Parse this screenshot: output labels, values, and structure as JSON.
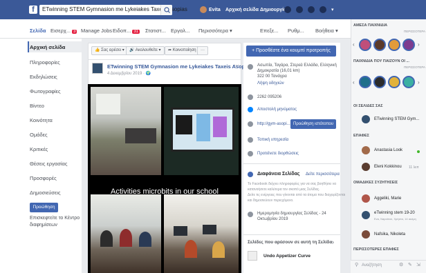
{
  "topbar": {
    "logo": "f",
    "search_value": "ETwinning STEM Gymnasion me Lykeiakes Taxeis Asopias",
    "user_name": "Evita",
    "home": "Αρχική σελίδα",
    "create": "Δημιουργία"
  },
  "tabs": [
    {
      "label": "Σελίδα"
    },
    {
      "label": "Εισερχ...",
      "badge": "3"
    },
    {
      "label": "Manage Jobs"
    },
    {
      "label": "Ειδοπ...",
      "badge": "31"
    },
    {
      "label": "Στατιστ..."
    },
    {
      "label": "Εργαλ..."
    },
    {
      "label": "Περισσότερα ▾"
    },
    {
      "label": "Επεξε..."
    },
    {
      "label": "Ρυθμ..."
    },
    {
      "label": "Βοήθεια ▾"
    }
  ],
  "leftnav": {
    "items": [
      "Αρχική σελίδα",
      "Πληροφορίες",
      "Εκδηλώσεις",
      "Φωτογραφίες",
      "Βίντεο",
      "Κοινότητα",
      "Ομάδες",
      "Κριτικές",
      "Θέσεις εργασίας",
      "Προσφορές",
      "Δημοσιεύσεις"
    ],
    "promote": "Προώθηση",
    "visit_line1": "Επισκεφτείτε το Κέντρο",
    "visit_line2": "διαφημίσεων"
  },
  "actions": [
    "👍 Σας αρέσει ▾",
    "🔊 Ακολουθείτε ▾",
    "➦ Κοινοποίηση",
    "···"
  ],
  "post": {
    "author": "ETwinning STEM Gymnasion me Lykeiakes Taxeis Asopias",
    "date": "4 Δεκεμβρίου 2019 · 🌍",
    "more": "···",
    "caption": "Activities microbits in our school"
  },
  "info": {
    "cta": "+ Προσθέστε ένα κουμπί προτροπής",
    "address": [
      "Ασωπία, Ταγάρα, Στερεά Ελλάδα, Ελληνική",
      "Δημοκρατία (16,01 km)",
      "322 00 Τανάγρα"
    ],
    "directions": "Λήψη οδηγιών",
    "phone": "2262 095206",
    "message": "Αποστολή μηνύματος",
    "website": "http://gym-asopi...",
    "send_btn": "Προώθηση ιστότοπου",
    "category": "Τοπική υπηρεσία",
    "suggest": "Προτείνετε διορθώσεις",
    "transparency_title": "Διαφάνεια Σελίδας",
    "transparency_more": "Δείτε περισσότερα",
    "transparency_text": [
      "Το Facebook δείχνει πληροφορίες για να σας βοηθήσει να",
      "κατανοήσετε καλύτερα τον σκοπό μιας Σελίδας.",
      "Δείτε τις ενέργειες που γίνονται από τα άτομα που διαχειρίζονται",
      "και δημοσιεύουν περιεχόμενο."
    ],
    "created_line1": "Ημερομηνία δημιουργίας Σελίδας - 24",
    "created_line2": "Οκτωβρίου 2019",
    "liked_pages": "Σελίδες που αρέσουν σε αυτή τη Σελίδα",
    "liked_page_name": "Undo Appetizer Curve"
  },
  "chat": {
    "stories_header": "ΑΜΕΣΑ ΠΑΙΧΝΙΔΙΑ",
    "more1": "ΠΕΡΙΣΣΟΤΕΡΑ",
    "games_header": "ΠΑΙΧΝΙΔΙΑ ΠΟΥ ΠΑΙΖΟΥΝ ΟΙ ...",
    "more2": "ΠΕΡΙΣΣΟΤΕΡΑ",
    "pages_header": "ΟΙ ΣΕΛΙΔΕΣ ΣΑΣ",
    "page_item": "ETwinning STEM Gym...",
    "contacts_header": "ΕΠΑΦΕΣ",
    "contacts": [
      {
        "name": "Anastasia Look",
        "status": ""
      },
      {
        "name": "Eleni Kokkinou",
        "status": "11 λεπ"
      }
    ],
    "groups_header": "ΟΜΑΔΙΚΕΣ ΣΥΖΗΤΗΣΕΙΣ",
    "groups": [
      {
        "name": "Aggeliki, Marie",
        "sub": ""
      },
      {
        "name": "eTwinning stem 19-20",
        "sub": "Eva, Napoleon, Χρήστα, 14 ακόμη"
      },
      {
        "name": "Nafsika, Nikoleta",
        "sub": ""
      }
    ],
    "more_contacts": "ΠΕΡΙΣΣΟΤΕΡΕΣ ΕΠΑΦΕΣ",
    "search_placeholder": "Αναζήτηση"
  },
  "colors": {
    "brand": "#3b5998",
    "button": "#4267b2",
    "online": "#42b72a"
  }
}
